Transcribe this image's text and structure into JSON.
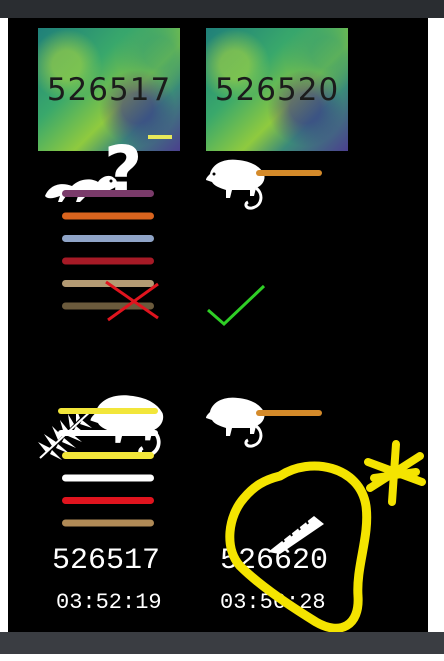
{
  "tiles": [
    {
      "id": "526517"
    },
    {
      "id": "526520"
    }
  ],
  "row1": {
    "left_question_mark": "?",
    "left_colors": [
      "#7a3b6a",
      "#d9641e",
      "#8fa4c7",
      "#a61a26",
      "#b39a73",
      "#6b5a3c"
    ],
    "right_color": "#d48a2a",
    "left_verdict_icon": "x-cross-icon",
    "right_verdict_icon": "check-icon",
    "cross_color": "#e0141e",
    "check_color": "#2fcf26"
  },
  "row2": {
    "left_colors": [
      "#f2e63a",
      "#ffffff",
      "#e0141e",
      "#b08a56"
    ],
    "left_overlay_colors": [
      "#f2e63a",
      "#ffffff"
    ],
    "right_color": "#d48a2a"
  },
  "footer": [
    {
      "id": "526517",
      "time": "03:52:19"
    },
    {
      "id": "526620",
      "time": "03:56:28"
    }
  ],
  "annotation_color": "#f4e400"
}
